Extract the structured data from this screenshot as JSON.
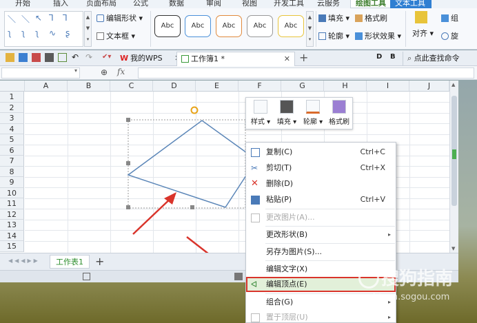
{
  "ribbon_tabs": [
    "开始",
    "插入",
    "页面布局",
    "公式",
    "数据",
    "审阅",
    "视图",
    "开发工具",
    "云服务",
    "绘图工具",
    "文本工具"
  ],
  "ribbon": {
    "edit_shape": "编辑形状",
    "text_box": "文本框",
    "abc": "Abc",
    "fill": "填充",
    "format_painter": "格式刷",
    "outline": "轮廓",
    "shape_effects": "形状效果",
    "align": "对齐",
    "group_short": "组",
    "rotate_short": "旋"
  },
  "docbar": {
    "wps_tab": "我的WPS",
    "workbook_tab": "工作簿1 *",
    "search": "点此查找命令",
    "fx": "fx"
  },
  "grid": {
    "columns": [
      "A",
      "B",
      "C",
      "D",
      "E",
      "F",
      "G",
      "H",
      "I",
      "J"
    ],
    "rows": [
      "1",
      "2",
      "3",
      "4",
      "5",
      "6",
      "7",
      "8",
      "9",
      "10",
      "11",
      "12",
      "13",
      "14",
      "15"
    ]
  },
  "sheet_tab": "工作表1",
  "float_toolbar": [
    {
      "label": "样式"
    },
    {
      "label": "填充"
    },
    {
      "label": "轮廓"
    },
    {
      "label": "格式刷"
    }
  ],
  "context_menu": [
    {
      "label": "复制(C)",
      "shortcut": "Ctrl+C"
    },
    {
      "label": "剪切(T)",
      "shortcut": "Ctrl+X"
    },
    {
      "label": "删除(D)",
      "shortcut": ""
    },
    {
      "label": "粘贴(P)",
      "shortcut": "Ctrl+V"
    },
    {
      "label": "更改图片(A)...",
      "shortcut": ""
    },
    {
      "label": "更改形状(B)",
      "shortcut": ""
    },
    {
      "label": "另存为图片(S)...",
      "shortcut": ""
    },
    {
      "label": "编辑文字(X)",
      "shortcut": ""
    },
    {
      "label": "编辑顶点(E)",
      "shortcut": ""
    },
    {
      "label": "组合(G)",
      "shortcut": ""
    },
    {
      "label": "置于顶层(U)",
      "shortcut": ""
    }
  ],
  "watermark": {
    "brand": "搜狗指南",
    "url": "zhinan.sogou.com"
  },
  "colors": {
    "ribbon_active": "#3f7f2f",
    "highlight_tab": "#2f7fd2",
    "menu_hover_bg": "#e2f0d9",
    "annotation_red": "#d9342b",
    "shape_stroke": "#5b86b8",
    "sheet_tab_green": "#2f8f2f"
  }
}
